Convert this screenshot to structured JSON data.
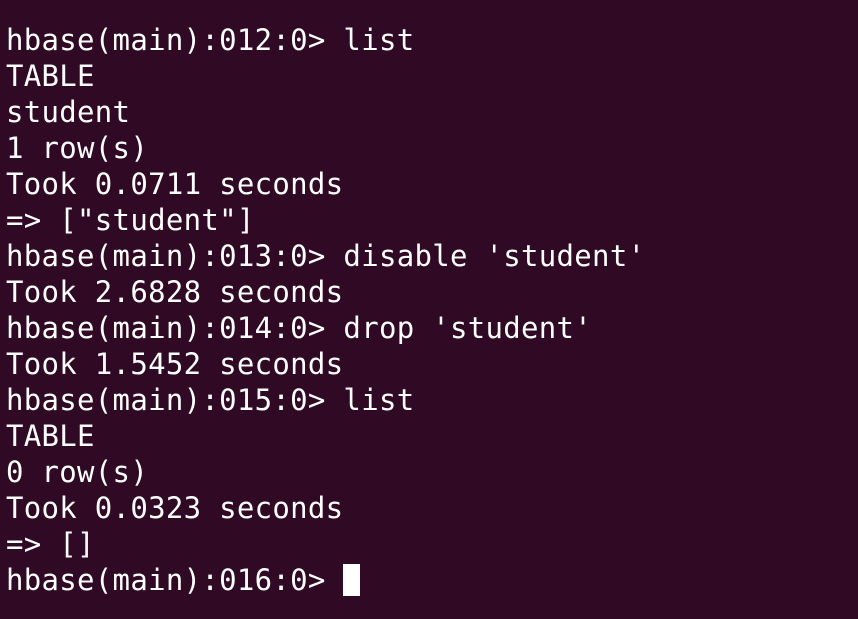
{
  "terminal": {
    "lines": [
      "hbase(main):012:0> list",
      "TABLE",
      "student",
      "1 row(s)",
      "Took 0.0711 seconds",
      "=> [\"student\"]",
      "hbase(main):013:0> disable 'student'",
      "Took 2.6828 seconds",
      "hbase(main):014:0> drop 'student'",
      "Took 1.5452 seconds",
      "hbase(main):015:0> list",
      "TABLE",
      "0 row(s)",
      "Took 0.0323 seconds",
      "=> []"
    ],
    "prompt": "hbase(main):016:0> ",
    "colors": {
      "background": "#300a24",
      "text": "#ffffff"
    }
  }
}
